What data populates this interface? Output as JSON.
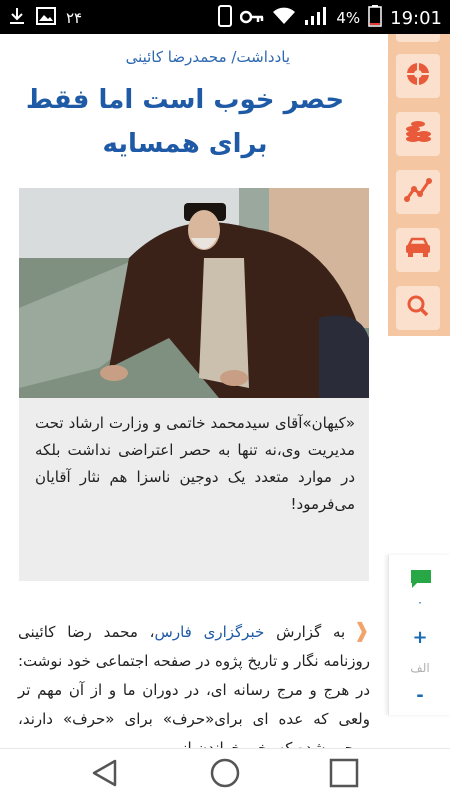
{
  "status_bar": {
    "notification_count": "۲۴",
    "battery_percent": "4%",
    "time": "19:01",
    "icons": [
      "download-icon",
      "image-icon",
      "phone-icon",
      "key-icon",
      "wifi-icon",
      "signal-icon",
      "battery-icon"
    ]
  },
  "article": {
    "kicker": "یادداشت/ محمدرضا کائینی",
    "headline": "حصر خوب است اما فقط برای همسایه",
    "photo_desc_icon": "photo",
    "caption": "«کیهان»آقای سیدمحمد خاتمی و وزارت ارشاد تحت مدیریت وی،نه تنها به حصر اعتراضی نداشت بلکه در موارد متعدد یک دوجین ناسزا هم نثار آقایان می‌فرمود!",
    "body_prefix": "به گزارش ",
    "body_link": "خبرگزاری فارس",
    "body_text": "، محمد رضا کائینی روزنامه نگار و تاریخ پژوه در صفحه اجتماعی خود نوشت: در هرج و مرج رسانه ای، در دوران ما و از آن مهم تر ولعی که عده ای برای«حرف» برای «حرف» دارند، موجب شده که، خبر خواندن از"
  },
  "sidebar": {
    "buttons": [
      "sports-icon",
      "coins-icon",
      "chart-icon",
      "car-icon",
      "search-icon"
    ]
  },
  "side_panel": {
    "comment_count": "۰",
    "font_plus": "+",
    "font_label": "الف",
    "font_minus": "-"
  },
  "colors": {
    "accent_blue": "#1f5aa6",
    "sidebar_orange": "#f4c6a2",
    "button_orange": "#e07a4a"
  }
}
